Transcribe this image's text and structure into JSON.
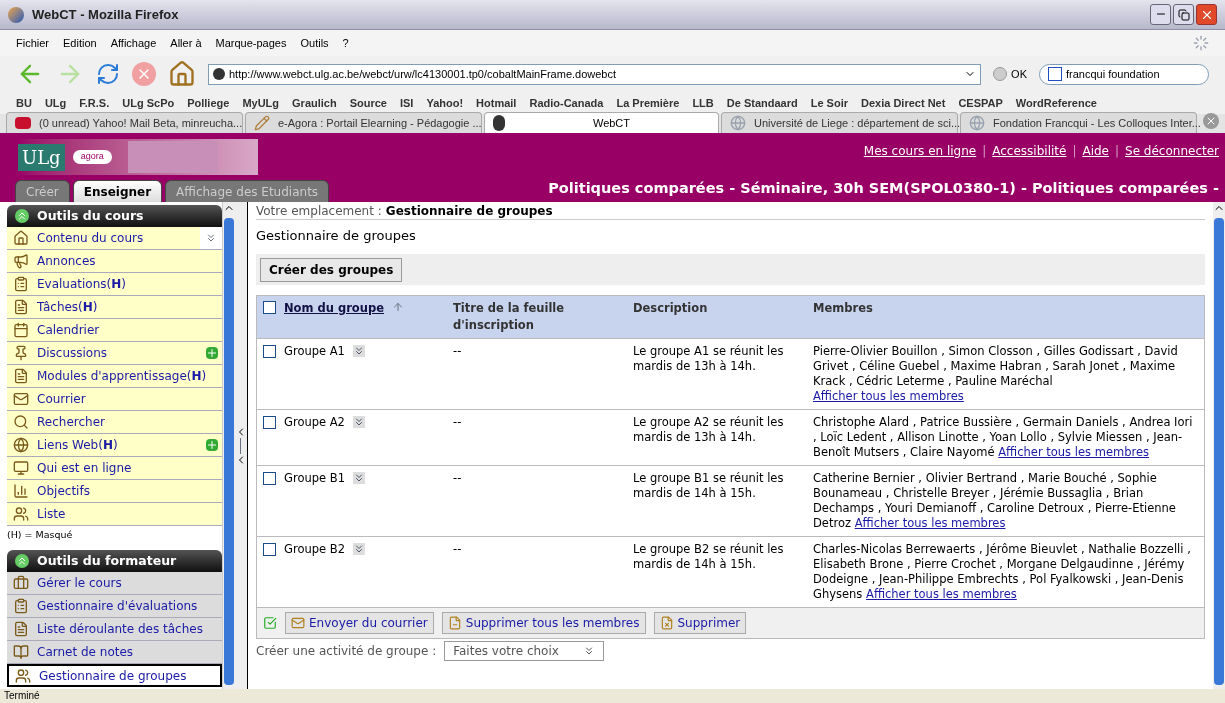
{
  "window": {
    "title": "WebCT - Mozilla Firefox"
  },
  "menu": [
    "Fichier",
    "Edition",
    "Affichage",
    "Aller à",
    "Marque-pages",
    "Outils",
    "?"
  ],
  "address": {
    "value": "http://www.webct.ulg.ac.be/webct/urw/lc4130001.tp0/cobaltMainFrame.dowebct",
    "go": "OK"
  },
  "search": {
    "value": "francqui foundation"
  },
  "bookmarks": [
    "BU",
    "ULg",
    "F.R.S.",
    "ULg ScPo",
    "Polliege",
    "MyULg",
    "Graulich",
    "Source",
    "ISI",
    "Yahoo!",
    "Hotmail",
    "Radio-Canada",
    "La Première",
    "LLB",
    "De Standaard",
    "Le Soir",
    "Dexia Direct Net",
    "CESPAP",
    "WordReference"
  ],
  "browser_tabs": [
    {
      "label": "(0 unread) Yahoo! Mail Beta, minreucha...",
      "kind": "yahoo",
      "selected": false
    },
    {
      "label": "e-Agora : Portail Elearning - Pédagogie ...",
      "kind": "tool",
      "selected": false
    },
    {
      "label": "WebCT",
      "kind": "webct",
      "selected": true
    },
    {
      "label": "Université de Liege : département de sci...",
      "kind": "globe",
      "selected": false
    },
    {
      "label": "Fondation Francqui - Les Colloques Inter...",
      "kind": "globe",
      "selected": false
    }
  ],
  "header": {
    "logo": "ULg",
    "logo_tag": "agora",
    "links": [
      "Mes cours en ligne",
      "Accessibilité",
      "Aide",
      "Se déconnecter"
    ],
    "link_separator": "|",
    "tabs": [
      {
        "label": "Créer",
        "selected": false
      },
      {
        "label": "Enseigner",
        "selected": true
      },
      {
        "label": "Affichage des Etudiants",
        "selected": false
      }
    ],
    "course_title": "Politiques comparées - Séminaire, 30h SEM(SPOL0380-1) - Politiques comparées -"
  },
  "sidebar": {
    "sections": [
      {
        "title": "Outils du cours",
        "kind": "course",
        "items": [
          {
            "label": "Contenu du cours",
            "new": false,
            "selected": false,
            "collapse": true
          },
          {
            "label": "Annonces",
            "new": false,
            "selected": false,
            "collapse": false
          },
          {
            "label": "Evaluations(**H**)",
            "new": false,
            "selected": false,
            "collapse": false
          },
          {
            "label": "Tâches(**H**)",
            "new": false,
            "selected": false,
            "collapse": false
          },
          {
            "label": "Calendrier",
            "new": false,
            "selected": false,
            "collapse": false
          },
          {
            "label": "Discussions",
            "new": true,
            "selected": false,
            "collapse": false
          },
          {
            "label": "Modules d'apprentissage(**H**)",
            "new": false,
            "selected": false,
            "collapse": false
          },
          {
            "label": "Courrier",
            "new": false,
            "selected": false,
            "collapse": false
          },
          {
            "label": "Rechercher",
            "new": false,
            "selected": false,
            "collapse": false
          },
          {
            "label": "Liens Web(**H**)",
            "new": true,
            "selected": false,
            "collapse": false
          },
          {
            "label": "Qui est en ligne",
            "new": false,
            "selected": false,
            "collapse": false
          },
          {
            "label": "Objectifs",
            "new": false,
            "selected": false,
            "collapse": false
          },
          {
            "label": "Liste",
            "new": false,
            "selected": false,
            "collapse": false
          }
        ],
        "note": "(H) = Masqué"
      },
      {
        "title": "Outils du formateur",
        "kind": "trainer",
        "items": [
          {
            "label": "Gérer le cours",
            "new": false,
            "selected": false,
            "collapse": false
          },
          {
            "label": "Gestionnaire d'évaluations",
            "new": false,
            "selected": false,
            "collapse": false
          },
          {
            "label": "Liste déroulante des tâches",
            "new": false,
            "selected": false,
            "collapse": false
          },
          {
            "label": "Carnet de notes",
            "new": false,
            "selected": false,
            "collapse": false
          },
          {
            "label": "Gestionnaire de groupes",
            "new": false,
            "selected": true,
            "collapse": false
          }
        ]
      }
    ]
  },
  "content": {
    "breadcrumb_label": "Votre emplacement :",
    "breadcrumb": "Gestionnaire de groupes",
    "title": "Gestionnaire de groupes",
    "create_button": "Créer des groupes",
    "table": {
      "select_all_checked": false,
      "columns": [
        "Nom du groupe",
        "Titre de la feuille d'inscription",
        "Description",
        "Membres"
      ],
      "rows": [
        {
          "name": "Groupe A1",
          "title": "--",
          "description": "Le groupe A1 se réunit les mardis de 13h à 14h.",
          "members": "Pierre-Olivier Bouillon , Simon Closson , Gilles Godissart , David Grivet , Céline Guebel , Maxime Habran , Sarah Jonet , Maxime Krack , Cédric Leterme , Pauline Maréchal",
          "link": "Afficher tous les membres",
          "checked": false
        },
        {
          "name": "Groupe A2",
          "title": "--",
          "description": "Le groupe A2 se réunit les mardis de 13h à 14h.",
          "members": "Christophe Alard , Patrice Bussière , Germain Daniels , Andrea Iori , Loïc Ledent , Allison Linotte , Yoan Lollo , Sylvie Miessen , Jean-Benoît Mutsers , Claire Nayomé",
          "link": "Afficher tous les membres",
          "checked": false
        },
        {
          "name": "Groupe B1",
          "title": "--",
          "description": "Le groupe B1 se réunit les mardis de 14h à 15h.",
          "members": "Catherine Bernier , Olivier Bertrand , Marie Bouché , Sophie Bounameau , Christelle Breyer , Jérémie Bussaglia , Brian Dechamps , Youri Demianoff , Caroline Detroux , Pierre-Etienne Detroz",
          "link": "Afficher tous les membres",
          "checked": false
        },
        {
          "name": "Groupe B2",
          "title": "--",
          "description": "Le groupe B2 se réunit les mardis de 14h à 15h.",
          "members": "Charles-Nicolas Berrewaerts , Jérôme Bieuvlet , Nathalie Bozzelli , Elisabeth Brone , Pierre Crochet , Morgane Delgaudinne , Jérémy Dodeigne , Jean-Philippe Embrechts , Pol Fyalkowski , Jean-Denis Ghysens",
          "link": "Afficher tous les membres",
          "checked": false
        }
      ]
    },
    "actions": [
      "Envoyer du courrier",
      "Supprimer tous les membres",
      "Supprimer"
    ],
    "activity": {
      "label": "Créer une activité de groupe :",
      "select": "Faites votre choix"
    }
  },
  "status_bar": "Terminé"
}
